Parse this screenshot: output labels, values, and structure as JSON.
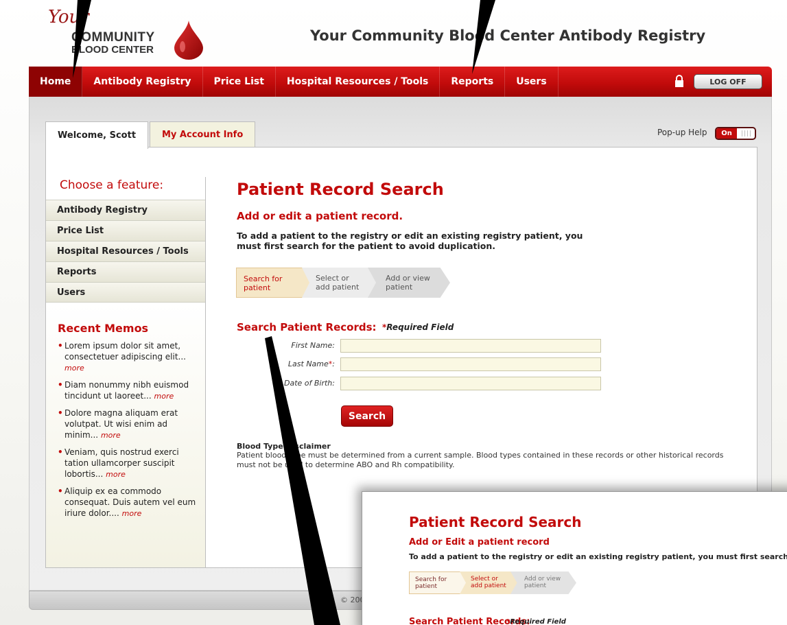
{
  "logo": {
    "your": "Your",
    "community": "COMMUNITY",
    "blood_center": "BLOOD CENTER"
  },
  "site_title": "Your Community Blood Center Antibody Registry",
  "nav": {
    "items": [
      {
        "label": "Home",
        "active": true
      },
      {
        "label": "Antibody Registry"
      },
      {
        "label": "Price List"
      },
      {
        "label": "Hospital Resources / Tools"
      },
      {
        "label": "Reports"
      },
      {
        "label": "Users"
      }
    ],
    "logoff": "LOG OFF"
  },
  "tabs": {
    "welcome": "Welcome, Scott",
    "account": "My Account Info"
  },
  "popup_help": {
    "label": "Pop-up Help",
    "state": "On"
  },
  "sidebar": {
    "heading": "Choose a feature:",
    "features": [
      "Antibody Registry",
      "Price List",
      "Hospital Resources / Tools",
      "Reports",
      "Users"
    ],
    "memos_heading": "Recent Memos",
    "memos": [
      {
        "text": "Lorem ipsum dolor sit amet, consectetuer adipiscing elit...",
        "more": "more"
      },
      {
        "text": "Diam nonummy nibh euismod tincidunt ut laoreet...",
        "more": "more"
      },
      {
        "text": "Dolore magna aliquam erat volutpat. Ut wisi enim ad minim...",
        "more": "more"
      },
      {
        "text": "Veniam, quis nostrud exerci tation ullamcorper suscipit lobortis...",
        "more": "more"
      },
      {
        "text": "Aliquip ex ea commodo consequat. Duis autem vel eum iriure dolor....",
        "more": "more"
      }
    ]
  },
  "main": {
    "title": "Patient Record Search",
    "subtitle": "Add or edit a patient record.",
    "instructions": "To add a patient to the registry or edit an existing registry patient, you must first search for the patient to avoid duplication.",
    "steps": {
      "step1_line1": "Search for",
      "step1_line2": "patient",
      "step2_line1": "Select or",
      "step2_line2": "add patient",
      "step3_line1": "Add or view",
      "step3_line2": "patient"
    },
    "search_heading": "Search Patient Records:",
    "required_note": "Required Field",
    "form": {
      "first_name_label": "First Name:",
      "last_name_label": "Last Name",
      "dob_label": "Date of Birth:",
      "first_name_value": "",
      "last_name_value": "",
      "dob_value": ""
    },
    "search_button": "Search",
    "disclaimer_title": "Blood Type Disclaimer",
    "disclaimer_text": "Patient blood type must be determined from a current sample. Blood types contained in these records or other historical records must not be used to determine ABO and Rh compatibility."
  },
  "footer": {
    "copyright": "© 200"
  },
  "zoom": {
    "title": "Patient Record Search",
    "subtitle": "Add or Edit a patient record",
    "instructions": "To add a patient to the registry or edit an existing registry patient, you must first search",
    "steps": {
      "step1_line1": "Search for",
      "step1_line2": "patient",
      "step2_line1": "Select or",
      "step2_line2": "add patient",
      "step3_line1": "Add or view",
      "step3_line2": "patient"
    },
    "search_heading": "Search Patient Records:",
    "required_note": "Required Field"
  },
  "colors": {
    "brand_red": "#c20b0b",
    "input_bg": "#faf8e3"
  }
}
